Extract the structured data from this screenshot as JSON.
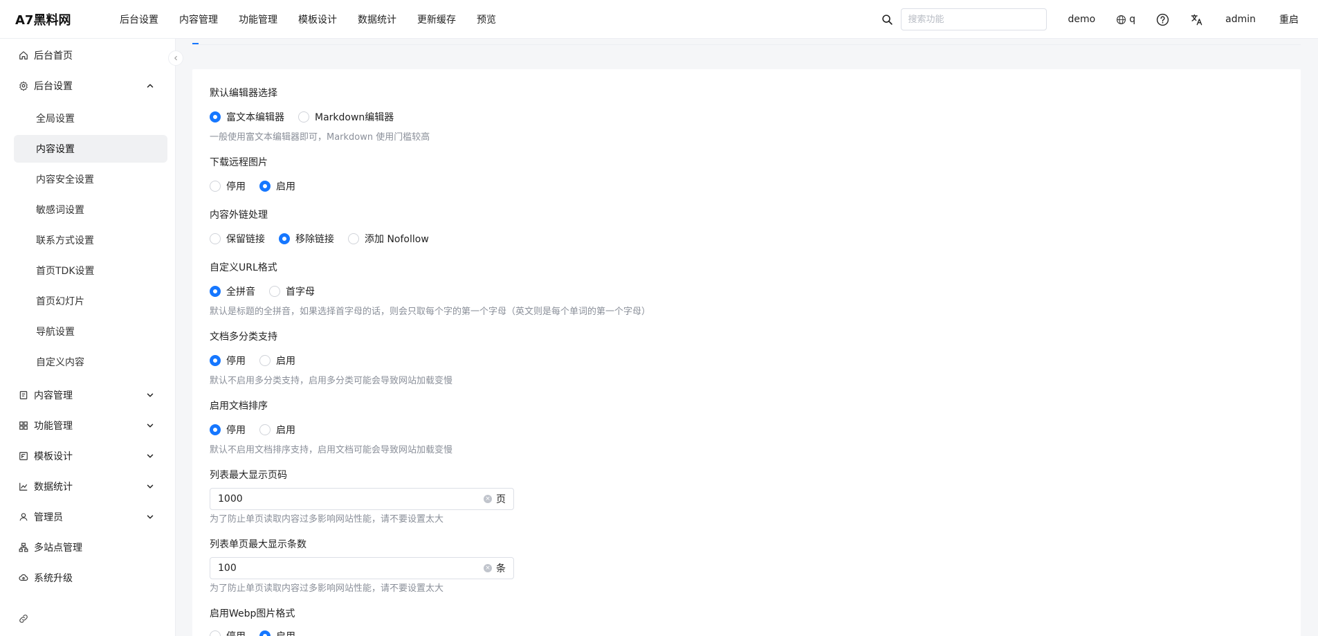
{
  "brand": "A7黑料网",
  "topnav": [
    "后台设置",
    "内容管理",
    "功能管理",
    "模板设计",
    "数据统计",
    "更新缓存",
    "预览"
  ],
  "search": {
    "placeholder": "搜索功能"
  },
  "top_right": {
    "site": "demo",
    "lang": "q",
    "user": "admin",
    "restart": "重启"
  },
  "sidebar": {
    "items": [
      {
        "label": "后台首页",
        "icon": "home-icon"
      },
      {
        "label": "后台设置",
        "icon": "gear-icon",
        "expanded": true
      },
      {
        "label": "内容管理",
        "icon": "file-list-icon"
      },
      {
        "label": "功能管理",
        "icon": "grid-icon"
      },
      {
        "label": "模板设计",
        "icon": "template-icon"
      },
      {
        "label": "数据统计",
        "icon": "line-chart-icon"
      },
      {
        "label": "管理员",
        "icon": "user-icon"
      },
      {
        "label": "多站点管理",
        "icon": "cluster-icon"
      },
      {
        "label": "系统升级",
        "icon": "cloud-sync-icon"
      }
    ],
    "subitems": [
      "全局设置",
      "内容设置",
      "内容安全设置",
      "敏感词设置",
      "联系方式设置",
      "首页TDK设置",
      "首页幻灯片",
      "导航设置",
      "自定义内容"
    ],
    "active_subitem": "内容设置"
  },
  "form": {
    "editor": {
      "label": "默认编辑器选择",
      "options": [
        "富文本编辑器",
        "Markdown编辑器"
      ],
      "selected": 0,
      "hint": "一般使用富文本编辑器即可，Markdown 使用门槛较高"
    },
    "remote_images": {
      "label": "下载远程图片",
      "options": [
        "停用",
        "启用"
      ],
      "selected": 1
    },
    "external_links": {
      "label": "内容外链处理",
      "options": [
        "保留链接",
        "移除链接",
        "添加 Nofollow"
      ],
      "selected": 1
    },
    "url_format": {
      "label": "自定义URL格式",
      "options": [
        "全拼音",
        "首字母"
      ],
      "selected": 0,
      "hint": "默认是标题的全拼音，如果选择首字母的话，则会只取每个字的第一个字母（英文则是每个单词的第一个字母）"
    },
    "multi_category": {
      "label": "文档多分类支持",
      "options": [
        "停用",
        "启用"
      ],
      "selected": 0,
      "hint": "默认不启用多分类支持，启用多分类可能会导致网站加载变慢"
    },
    "doc_sort": {
      "label": "启用文档排序",
      "options": [
        "停用",
        "启用"
      ],
      "selected": 0,
      "hint": "默认不启用文档排序支持，启用文档可能会导致网站加载变慢"
    },
    "max_pages": {
      "label": "列表最大显示页码",
      "value": "1000",
      "suffix": "页",
      "hint": "为了防止单页读取内容过多影响网站性能，请不要设置太大"
    },
    "max_items": {
      "label": "列表单页最大显示条数",
      "value": "100",
      "suffix": "条",
      "hint": "为了防止单页读取内容过多影响网站性能，请不要设置太大"
    },
    "webp": {
      "label": "启用Webp图片格式",
      "options": [
        "停用",
        "启用"
      ],
      "selected": 1
    }
  },
  "colors": {
    "accent": "#1677ff",
    "hint": "#8a8f99",
    "active_bg": "#f0f1f3"
  }
}
